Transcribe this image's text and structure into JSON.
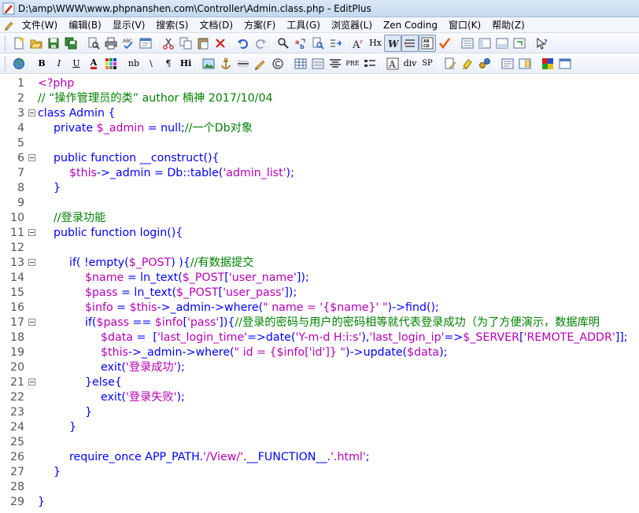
{
  "window": {
    "title": "D:\\amp\\WWW\\www.phpnanshen.com\\Controller\\Admin.class.php - EditPlus"
  },
  "menu": [
    "文件(W)",
    "编辑(B)",
    "显示(V)",
    "搜索(S)",
    "文档(D)",
    "方案(F)",
    "工具(G)",
    "浏览器(L)",
    "Zen Coding",
    "窗口(K)",
    "帮助(Z)"
  ],
  "toolbar2_text": {
    "bold": "B",
    "italic": "I",
    "underline": "U",
    "font_color": "A",
    "nb": "nb",
    "br": "\\",
    "para": "¶",
    "hi": "Hi",
    "pre": "PRE",
    "div": "div",
    "sp": "SP",
    "hx": "Hx",
    "az": "A",
    "abc": "ABC",
    "abcd": "AB CD"
  },
  "editor": {
    "lines": [
      {
        "n": "1",
        "fold": false,
        "indent": 0,
        "tokens": [
          [
            "tag",
            "<?php"
          ]
        ]
      },
      {
        "n": "2",
        "fold": false,
        "indent": 0,
        "tokens": [
          [
            "cm",
            "// “操作管理员的类” author 楠神 2017/10/04"
          ]
        ]
      },
      {
        "n": "3",
        "fold": true,
        "indent": 0,
        "tokens": [
          [
            "kw",
            "class Admin {"
          ]
        ]
      },
      {
        "n": "4",
        "fold": false,
        "indent": 1,
        "tokens": [
          [
            "kw",
            "private "
          ],
          [
            "var",
            "$_admin"
          ],
          [
            "kw",
            " = null;"
          ],
          [
            "cm",
            "//一个Db对象"
          ]
        ]
      },
      {
        "n": "5",
        "fold": false,
        "indent": 0,
        "tokens": []
      },
      {
        "n": "6",
        "fold": true,
        "indent": 1,
        "tokens": [
          [
            "kw",
            "public function __construct(){"
          ]
        ]
      },
      {
        "n": "7",
        "fold": false,
        "indent": 2,
        "tokens": [
          [
            "var",
            "$this"
          ],
          [
            "kw",
            "->_admin = Db::table("
          ],
          [
            "str",
            "'admin_list'"
          ],
          [
            "kw",
            ");"
          ]
        ]
      },
      {
        "n": "8",
        "fold": false,
        "indent": 1,
        "tokens": [
          [
            "kw",
            "}"
          ]
        ]
      },
      {
        "n": "9",
        "fold": false,
        "indent": 0,
        "tokens": []
      },
      {
        "n": "10",
        "fold": false,
        "indent": 1,
        "tokens": [
          [
            "cm",
            "//登录功能"
          ]
        ]
      },
      {
        "n": "11",
        "fold": true,
        "indent": 1,
        "tokens": [
          [
            "kw",
            "public function login(){"
          ]
        ]
      },
      {
        "n": "12",
        "fold": false,
        "indent": 0,
        "tokens": []
      },
      {
        "n": "13",
        "fold": true,
        "indent": 2,
        "tokens": [
          [
            "kw",
            "if( !empty("
          ],
          [
            "var",
            "$_POST"
          ],
          [
            "kw",
            ") ){"
          ],
          [
            "cm",
            "//有数据提交"
          ]
        ]
      },
      {
        "n": "14",
        "fold": false,
        "indent": 3,
        "tokens": [
          [
            "var",
            "$name"
          ],
          [
            "kw",
            " = ln_text("
          ],
          [
            "var",
            "$_POST"
          ],
          [
            "kw",
            "["
          ],
          [
            "str",
            "'user_name'"
          ],
          [
            "kw",
            "]);"
          ]
        ]
      },
      {
        "n": "15",
        "fold": false,
        "indent": 3,
        "tokens": [
          [
            "var",
            "$pass"
          ],
          [
            "kw",
            " = ln_text("
          ],
          [
            "var",
            "$_POST"
          ],
          [
            "kw",
            "["
          ],
          [
            "str",
            "'user_pass'"
          ],
          [
            "kw",
            "]);"
          ]
        ]
      },
      {
        "n": "16",
        "fold": false,
        "indent": 3,
        "tokens": [
          [
            "var",
            "$info"
          ],
          [
            "kw",
            " = "
          ],
          [
            "var",
            "$this"
          ],
          [
            "kw",
            "->_admin->where("
          ],
          [
            "str",
            "\" name = '{$name}' \""
          ],
          [
            "kw",
            ")->find();"
          ]
        ]
      },
      {
        "n": "17",
        "fold": true,
        "indent": 3,
        "tokens": [
          [
            "kw",
            "if("
          ],
          [
            "var",
            "$pass"
          ],
          [
            "kw",
            " == "
          ],
          [
            "var",
            "$info"
          ],
          [
            "kw",
            "["
          ],
          [
            "str",
            "'pass'"
          ],
          [
            "kw",
            "]){"
          ],
          [
            "cm",
            "//登录的密码与用户的密码相等就代表登录成功（为了方便演示，数据库明"
          ]
        ]
      },
      {
        "n": "18",
        "fold": false,
        "indent": 4,
        "tokens": [
          [
            "var",
            "$data"
          ],
          [
            "kw",
            " =  ["
          ],
          [
            "str",
            "'last_login_time'"
          ],
          [
            "kw",
            "=>date("
          ],
          [
            "str",
            "'Y-m-d H:i:s'"
          ],
          [
            "kw",
            "),"
          ],
          [
            "str",
            "'last_login_ip'"
          ],
          [
            "kw",
            "=>"
          ],
          [
            "var",
            "$_SERVER"
          ],
          [
            "kw",
            "["
          ],
          [
            "str",
            "'REMOTE_ADDR'"
          ],
          [
            "kw",
            "]];"
          ]
        ]
      },
      {
        "n": "19",
        "fold": false,
        "indent": 4,
        "tokens": [
          [
            "var",
            "$this"
          ],
          [
            "kw",
            "->_admin->where("
          ],
          [
            "str",
            "\" id = {$info['id']} \""
          ],
          [
            "kw",
            ")->update("
          ],
          [
            "var",
            "$data"
          ],
          [
            "kw",
            ");"
          ]
        ]
      },
      {
        "n": "20",
        "fold": false,
        "indent": 4,
        "tokens": [
          [
            "kw",
            "exit("
          ],
          [
            "str",
            "'登录成功'"
          ],
          [
            "kw",
            ");"
          ]
        ]
      },
      {
        "n": "21",
        "fold": true,
        "indent": 3,
        "tokens": [
          [
            "kw",
            "}else{"
          ]
        ]
      },
      {
        "n": "22",
        "fold": false,
        "indent": 4,
        "tokens": [
          [
            "kw",
            "exit("
          ],
          [
            "str",
            "'登录失败'"
          ],
          [
            "kw",
            ");"
          ]
        ]
      },
      {
        "n": "23",
        "fold": false,
        "indent": 3,
        "tokens": [
          [
            "kw",
            "}"
          ]
        ]
      },
      {
        "n": "24",
        "fold": false,
        "indent": 2,
        "tokens": [
          [
            "kw",
            "}"
          ]
        ]
      },
      {
        "n": "25",
        "fold": false,
        "indent": 0,
        "tokens": []
      },
      {
        "n": "26",
        "fold": false,
        "indent": 2,
        "tokens": [
          [
            "kw",
            "require_once APP_PATH."
          ],
          [
            "str",
            "'/View/'"
          ],
          [
            "kw",
            ".__FUNCTION__."
          ],
          [
            "str",
            "'.html'"
          ],
          [
            "kw",
            ";"
          ]
        ]
      },
      {
        "n": "27",
        "fold": false,
        "indent": 1,
        "tokens": [
          [
            "kw",
            "}"
          ]
        ]
      },
      {
        "n": "28",
        "fold": false,
        "indent": 0,
        "tokens": []
      },
      {
        "n": "29",
        "fold": false,
        "indent": 0,
        "tokens": [
          [
            "kw",
            "}"
          ]
        ]
      }
    ]
  },
  "colors": {
    "keyword": "#0000ff",
    "variable": "#b400b4",
    "string": "#b400b4",
    "comment": "#008000"
  }
}
